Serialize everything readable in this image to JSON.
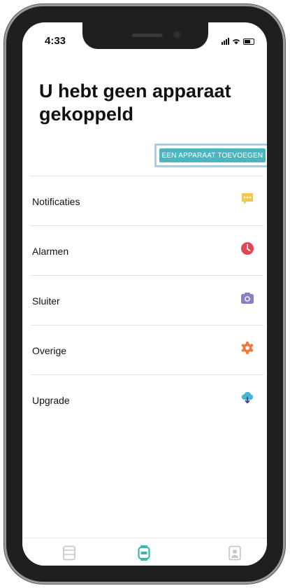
{
  "status_bar": {
    "time": "4:33"
  },
  "page": {
    "title": "U hebt geen apparaat gekoppeld"
  },
  "add_button": {
    "label": "EEN APPARAAT TOEVOEGEN"
  },
  "menu": {
    "items": [
      {
        "label": "Notificaties",
        "icon": "message-icon",
        "color": "#f5c84c"
      },
      {
        "label": "Alarmen",
        "icon": "clock-icon",
        "color": "#e84355"
      },
      {
        "label": "Sluiter",
        "icon": "camera-icon",
        "color": "#8b7fc2"
      },
      {
        "label": "Overige",
        "icon": "gear-icon",
        "color": "#ef7a3c"
      },
      {
        "label": "Upgrade",
        "icon": "cloud-download-icon",
        "color": "#4ab5d6"
      }
    ]
  },
  "tab_bar": {
    "tabs": [
      {
        "icon": "activity-icon",
        "active": false
      },
      {
        "icon": "watch-icon",
        "active": true
      },
      {
        "icon": "profile-icon",
        "active": false
      }
    ],
    "active_color": "#3fb7a8",
    "inactive_color": "#c8c8c8"
  }
}
